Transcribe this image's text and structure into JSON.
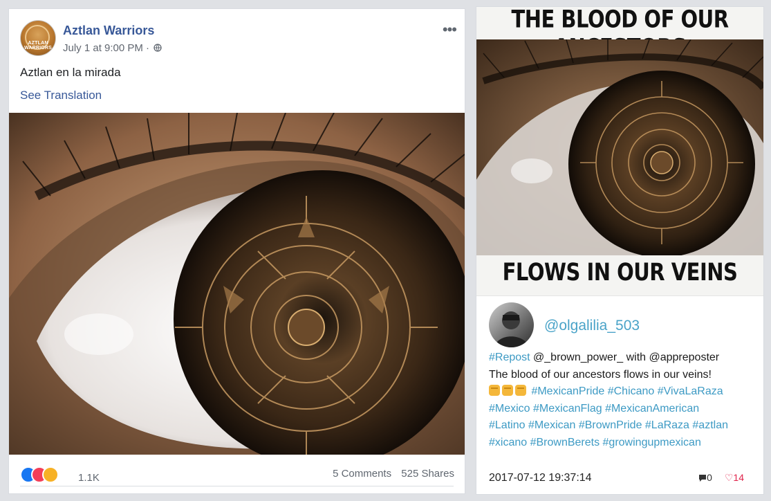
{
  "facebook_post": {
    "page_name": "Aztlan Warriors",
    "avatar_text": "AZTLAN WARRIORS",
    "timestamp": "July 1 at 9:00 PM ·",
    "more_icon": "more-dots-icon",
    "text": "Aztlan en la mirada",
    "see_translation": "See Translation",
    "reactions_icons": [
      "like-icon",
      "love-icon",
      "wow-icon"
    ],
    "reaction_count": "1.1K",
    "comments": "5 Comments",
    "shares": "525 Shares"
  },
  "instagram_post": {
    "meme_top_text": "THE BLOOD OF OUR ANCESTORS",
    "meme_bottom_text": "FLOWS IN OUR VEINS",
    "username": "@olgalilia_503",
    "caption": {
      "repost_tag": "#Repost",
      "line1_rest": " @_brown_power_ with @appreposter",
      "line2": "The blood of our ancestors flows in our veins!",
      "line3_tags": "#MexicanPride #Chicano #VivaLaRaza",
      "line4_tags": "#Mexico #MexicanFlag #MexicanAmerican",
      "line5_tags": "#Latino #Mexican #BrownPride #LaRaza #aztlan",
      "line6_tags": "#xicano #BrownBerets #growingupmexican"
    },
    "datetime": "2017-07-12 19:37:14",
    "comment_count": "0",
    "like_count": "14",
    "colors": {
      "link": "#3d9ac4",
      "heart": "#e0244b"
    }
  }
}
